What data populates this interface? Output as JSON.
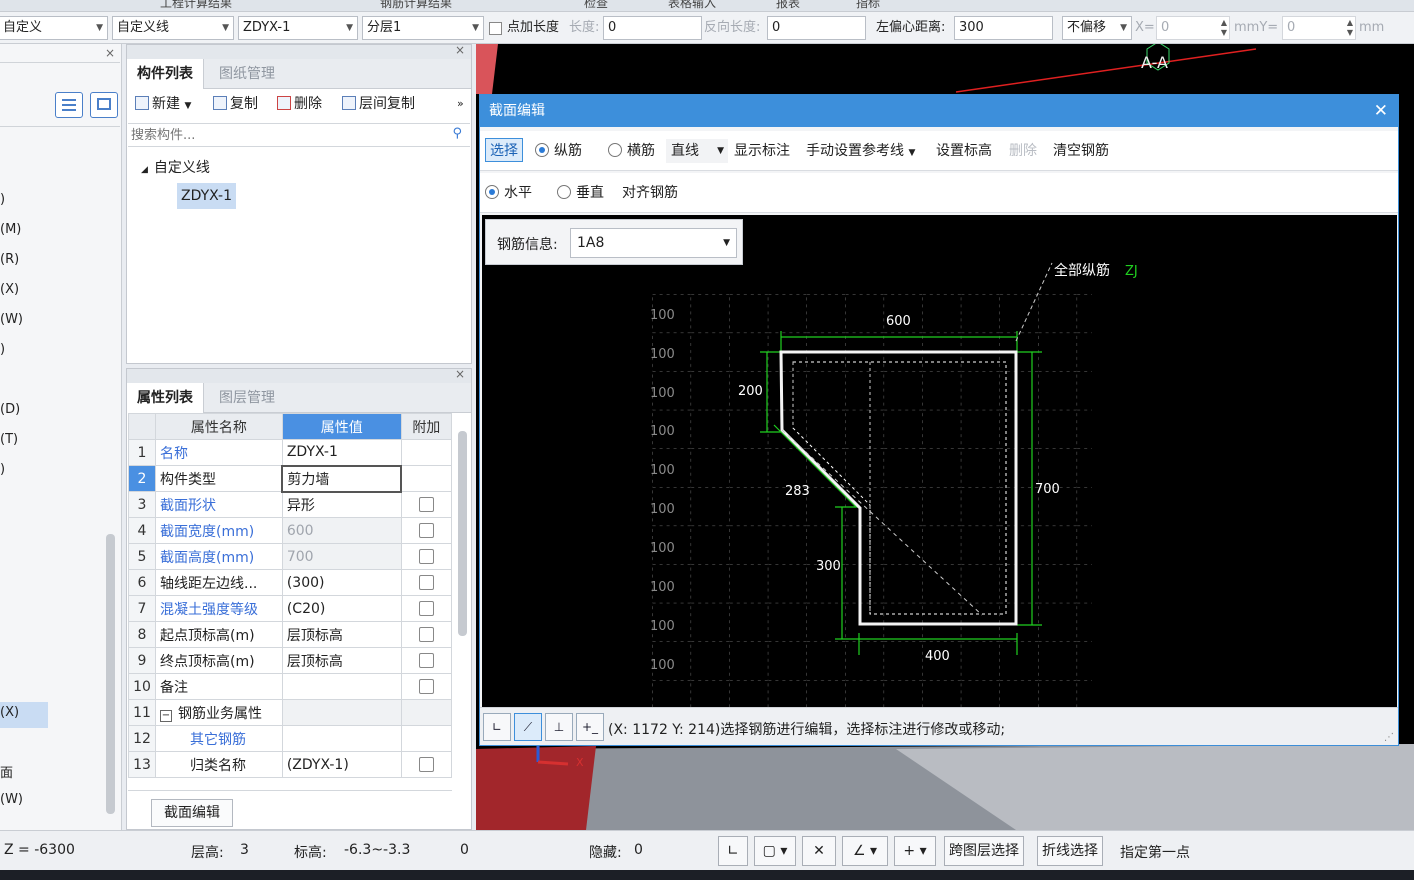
{
  "top_strip": {
    "items": [
      "工程计算结果",
      "钢筋计算结果",
      "检查",
      "表格输入",
      "报表",
      "指标"
    ]
  },
  "toolbar": {
    "combo1": "自定义",
    "combo2": "自定义线",
    "combo3": "ZDYX-1",
    "combo4": "分层1",
    "add_length_label": "点加长度",
    "length_label": "长度:",
    "length_value": "0",
    "reverse_length_label": "反向长度:",
    "reverse_length_value": "0",
    "left_offset_label": "左偏心距离:",
    "left_offset_value": "300",
    "offset_mode": "不偏移",
    "x_label": "X=",
    "x_value": "0",
    "mmy_label": "mmY=",
    "y_value": "0",
    "mm_label": "mm"
  },
  "left_partial": {
    "items": [
      ")",
      "(M)",
      "(R)",
      "(X)",
      "(W)",
      ")",
      "(D)",
      "(T)",
      ")",
      "(X)",
      "面",
      "(W)"
    ]
  },
  "component_panel": {
    "tab_active": "构件列表",
    "tab_inactive": "图纸管理",
    "btn_new": "新建",
    "btn_copy": "复制",
    "btn_delete": "删除",
    "btn_floor_copy": "层间复制",
    "search_placeholder": "搜索构件...",
    "tree_root": "自定义线",
    "tree_child": "ZDYX-1"
  },
  "property_panel": {
    "tab_active": "属性列表",
    "tab_inactive": "图层管理",
    "col_name": "属性名称",
    "col_value": "属性值",
    "col_extra": "附加",
    "rows": [
      {
        "n": "1",
        "name": "名称",
        "value": "ZDYX-1"
      },
      {
        "n": "2",
        "name": "构件类型",
        "value": "剪力墙"
      },
      {
        "n": "3",
        "name": "截面形状",
        "value": "异形"
      },
      {
        "n": "4",
        "name": "截面宽度(mm)",
        "value": "600"
      },
      {
        "n": "5",
        "name": "截面高度(mm)",
        "value": "700"
      },
      {
        "n": "6",
        "name": "轴线距左边线...",
        "value": "(300)"
      },
      {
        "n": "7",
        "name": "混凝土强度等级",
        "value": "(C20)"
      },
      {
        "n": "8",
        "name": "起点顶标高(m)",
        "value": "层顶标高"
      },
      {
        "n": "9",
        "name": "终点顶标高(m)",
        "value": "层顶标高"
      },
      {
        "n": "10",
        "name": "备注",
        "value": ""
      },
      {
        "n": "11",
        "name": "钢筋业务属性",
        "value": ""
      },
      {
        "n": "12",
        "name": "其它钢筋",
        "value": ""
      },
      {
        "n": "13",
        "name": "归类名称",
        "value": "(ZDYX-1)"
      }
    ],
    "section_edit_button": "截面编辑"
  },
  "viewport": {
    "label": "A-A"
  },
  "dialog": {
    "title": "截面编辑",
    "toolbar1": {
      "select": "选择",
      "longitudinal": "纵筋",
      "transverse": "横筋",
      "line": "直线",
      "show_dim": "显示标注",
      "manual_ref": "手动设置参考线",
      "set_elev": "设置标高",
      "delete": "删除",
      "clear": "清空钢筋"
    },
    "toolbar2": {
      "horizontal": "水平",
      "vertical": "垂直",
      "align": "对齐钢筋"
    },
    "rebar_info_label": "钢筋信息:",
    "rebar_info_value": "1A8",
    "all_longitudinal_label": "全部纵筋",
    "zj_label": "ZJ",
    "dims": {
      "top": "600",
      "left": "200",
      "diag": "283",
      "mid": "300",
      "bottom": "400",
      "right": "700"
    },
    "grid_label": "100",
    "status_text": "(X: 1172 Y: 214)选择钢筋进行编辑，选择标注进行修改或移动;"
  },
  "bottom": {
    "z": "Z = -6300",
    "floor_height_label": "层高:",
    "floor_height": "3",
    "elev_label": "标高:",
    "elev": "-6.3~-3.3",
    "zero": "0",
    "hidden_label": "隐藏:",
    "hidden": "0",
    "cross_floor": "跨图层选择",
    "polyline_select": "折线选择",
    "first_point": "指定第一点"
  }
}
